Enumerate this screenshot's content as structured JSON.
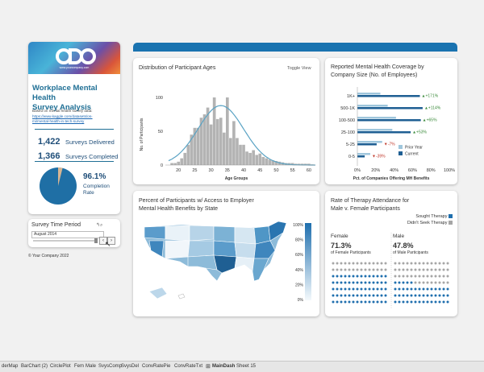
{
  "sidebar": {
    "logo_text": "www.yourcompany.com",
    "title_line1": "Workplace Mental Health",
    "title_line2": "Survey Analysis",
    "source_label": "Based on mental health survey data:",
    "source_link_line1": "https://www.kaggle.com/datasets/os-",
    "source_link_line2": "mi/mental-health-in-tech-survey",
    "surveys_delivered_num": "1,422",
    "surveys_delivered_label": "Surveys Delivered",
    "surveys_completed_num": "1,366",
    "surveys_completed_label": "Surveys Completed",
    "completion_pct": "96.1%",
    "completion_label_1": "Completion",
    "completion_label_2": "Rate",
    "completion_value": 0.961
  },
  "time_period": {
    "title": "Survey Time Period",
    "value": "August 2014"
  },
  "copyright": "© Your Company 2022",
  "age_chart": {
    "title": "Distribution of Participant Ages",
    "toggle_label": "Toggle View",
    "ylabel": "No. of Participants",
    "xlabel": "Age Groups",
    "xticks": [
      "20",
      "25",
      "30",
      "35",
      "40",
      "45",
      "50",
      "55",
      "60"
    ],
    "yticks": [
      "0",
      "50",
      "100"
    ]
  },
  "coverage_chart": {
    "title_line1": "Reported Mental Health Coverage by",
    "title_line2": "Company Size (No. of Employees)",
    "xlabel": "Pct. of Companies Offering MH Benefits",
    "xticks": [
      "0%",
      "20%",
      "40%",
      "60%",
      "80%",
      "100%"
    ],
    "legend": [
      "Prior Year",
      "Current"
    ]
  },
  "map_chart": {
    "title_line1": "Percent of Participants w/ Access to Employer",
    "title_line2": "Mental Health Benefits by State",
    "legend_ticks": [
      "100%",
      "80%",
      "60%",
      "40%",
      "20%",
      "0%"
    ]
  },
  "therapy_chart": {
    "title_line1": "Rate of Therapy Attendance for",
    "title_line2": "Male v. Female Participants",
    "legend": [
      "Sought Therapy",
      "Didn't Seek Therapy"
    ],
    "female_label": "Female",
    "female_pct": "71.3%",
    "female_sub": "of Female Participants",
    "female_value": 0.713,
    "male_label": "Male",
    "male_pct": "47.8%",
    "male_sub": "of Male Participants",
    "male_value": 0.478
  },
  "tabs": [
    "derMap",
    "BarChart (2)",
    "CirclePlot",
    "Fem",
    "Male",
    "SvysComp",
    "SvysDel",
    "ConvRatePie",
    "ConvRateTxt",
    "MainDash",
    "Sheet 15"
  ],
  "chart_data": [
    {
      "type": "bar",
      "title": "Distribution of Participant Ages",
      "xlabel": "Age Groups",
      "ylabel": "No. of Participants",
      "categories": [
        18,
        19,
        20,
        21,
        22,
        23,
        24,
        25,
        26,
        27,
        28,
        29,
        30,
        31,
        32,
        33,
        34,
        35,
        36,
        37,
        38,
        39,
        40,
        41,
        42,
        43,
        44,
        45,
        46,
        47,
        48,
        49,
        50,
        51,
        52,
        53,
        54,
        55,
        56,
        57,
        58,
        59,
        60,
        61
      ],
      "values": [
        3,
        3,
        5,
        10,
        18,
        30,
        45,
        55,
        55,
        70,
        75,
        85,
        60,
        100,
        68,
        70,
        48,
        100,
        40,
        65,
        40,
        30,
        30,
        20,
        18,
        22,
        15,
        17,
        12,
        10,
        8,
        7,
        6,
        5,
        4,
        3,
        3,
        3,
        2,
        2,
        2,
        2,
        2,
        1
      ],
      "xlim": [
        16,
        62
      ],
      "ylim": [
        0,
        125
      ]
    },
    {
      "type": "bar",
      "title": "Reported Mental Health Coverage by Company Size (No. of Employees)",
      "xlabel": "Pct. of Companies Offering MH Benefits",
      "categories": [
        "1K+",
        "500-1K",
        "100-500",
        "25-100",
        "5-25",
        "0-5"
      ],
      "series": [
        {
          "name": "Prior Year",
          "values": [
            25,
            33,
            42,
            38,
            27,
            14
          ]
        },
        {
          "name": "Current",
          "values": [
            68,
            71,
            69,
            58,
            21,
            8
          ]
        }
      ],
      "annotations": [
        "+171%",
        "+114%",
        "+65%",
        "+53%",
        "-7%",
        "-39%"
      ],
      "xlim": [
        0,
        100
      ]
    },
    {
      "type": "pie",
      "title": "Completion Rate",
      "categories": [
        "Completed",
        "Not Completed"
      ],
      "values": [
        96.1,
        3.9
      ]
    }
  ]
}
